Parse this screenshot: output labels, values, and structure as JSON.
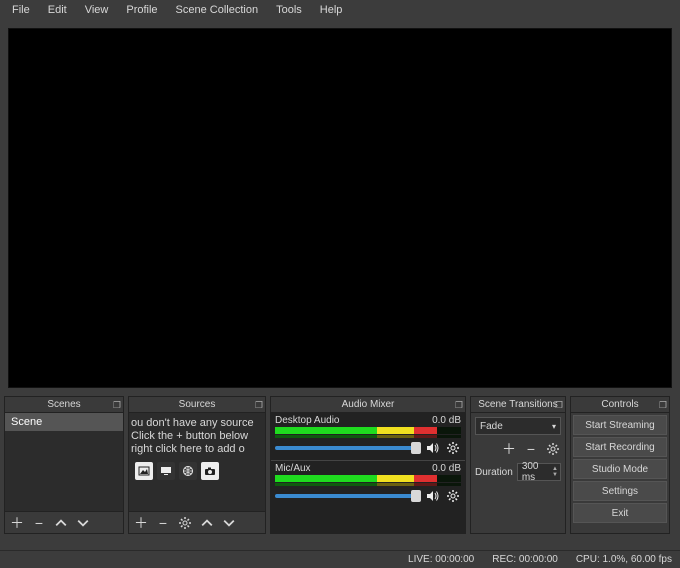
{
  "menubar": [
    "File",
    "Edit",
    "View",
    "Profile",
    "Scene Collection",
    "Tools",
    "Help"
  ],
  "docks": {
    "scenes": {
      "title": "Scenes",
      "items": [
        "Scene"
      ]
    },
    "sources": {
      "title": "Sources",
      "hint": "ou don't have any source\nClick the + button below\nright click here to add o"
    },
    "mixer": {
      "title": "Audio Mixer",
      "channels": [
        {
          "name": "Desktop Audio",
          "db": "0.0 dB"
        },
        {
          "name": "Mic/Aux",
          "db": "0.0 dB"
        }
      ]
    },
    "transitions": {
      "title": "Scene Transitions",
      "selected": "Fade",
      "duration_label": "Duration",
      "duration_value": "300 ms"
    },
    "controls": {
      "title": "Controls",
      "buttons": [
        "Start Streaming",
        "Start Recording",
        "Studio Mode",
        "Settings",
        "Exit"
      ]
    }
  },
  "status": {
    "live": "LIVE: 00:00:00",
    "rec": "REC: 00:00:00",
    "cpu": "CPU: 1.0%, 60.00 fps"
  }
}
